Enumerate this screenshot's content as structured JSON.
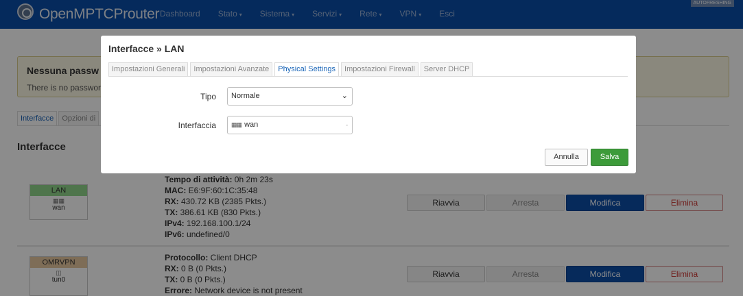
{
  "header": {
    "brand": "OpenMPTCProuter",
    "nav": [
      {
        "label": "Dashboard",
        "has_caret": false
      },
      {
        "label": "Stato",
        "has_caret": true
      },
      {
        "label": "Sistema",
        "has_caret": true
      },
      {
        "label": "Servizi",
        "has_caret": true
      },
      {
        "label": "Rete",
        "has_caret": true
      },
      {
        "label": "VPN",
        "has_caret": true
      },
      {
        "label": "Esci",
        "has_caret": false
      }
    ],
    "badge": "AUTOFRESHING"
  },
  "alert": {
    "title": "Nessuna passw",
    "text": "There is no password"
  },
  "page_tabs": [
    "Interfacce",
    "Opzioni di"
  ],
  "section_title": "Interfacce",
  "interfaces": [
    {
      "name": "LAN",
      "device": "wan",
      "info": [
        {
          "key": "Tempo di attività:",
          "value": " 0h 2m 23s"
        },
        {
          "key": "MAC:",
          "value": " E6:9F:60:1C:35:48"
        },
        {
          "key": "RX:",
          "value": " 430.72 KB (2385 Pkts.)"
        },
        {
          "key": "TX:",
          "value": " 386.61 KB (830 Pkts.)"
        },
        {
          "key": "IPv4:",
          "value": " 192.168.100.1/24"
        },
        {
          "key": "IPv6:",
          "value": " undefined/0"
        }
      ]
    },
    {
      "name": "OMRVPN",
      "device": "tun0",
      "info": [
        {
          "key": "Protocollo:",
          "value": " Client DHCP"
        },
        {
          "key": "RX:",
          "value": " 0 B (0 Pkts.)"
        },
        {
          "key": "TX:",
          "value": " 0 B (0 Pkts.)"
        },
        {
          "key": "Errore:",
          "value": " Network device is not present"
        }
      ]
    }
  ],
  "row_buttons": {
    "restart": "Riavvia",
    "stop": "Arresta",
    "edit": "Modifica",
    "delete": "Elimina"
  },
  "modal": {
    "title": "Interfacce » LAN",
    "tabs": [
      {
        "label": "Impostazioni Generali",
        "active": false
      },
      {
        "label": "Impostazioni Avanzate",
        "active": false
      },
      {
        "label": "Physical Settings",
        "active": true
      },
      {
        "label": "Impostazioni Firewall",
        "active": false
      },
      {
        "label": "Server DHCP",
        "active": false
      }
    ],
    "fields": {
      "tipo_label": "Tipo",
      "tipo_value": "Normale",
      "interfaccia_label": "Interfaccia",
      "interfaccia_value": "wan"
    },
    "cancel_label": "Annulla",
    "save_label": "Salva"
  },
  "colors": {
    "header": "#0a4ea8",
    "accent_tab": "#1b66b8",
    "save": "#3d9b3a",
    "edit": "#0c4ea7",
    "delete": "#c9302c",
    "lan_badge": "#90d58a",
    "vpn_badge": "#e6c69e"
  }
}
